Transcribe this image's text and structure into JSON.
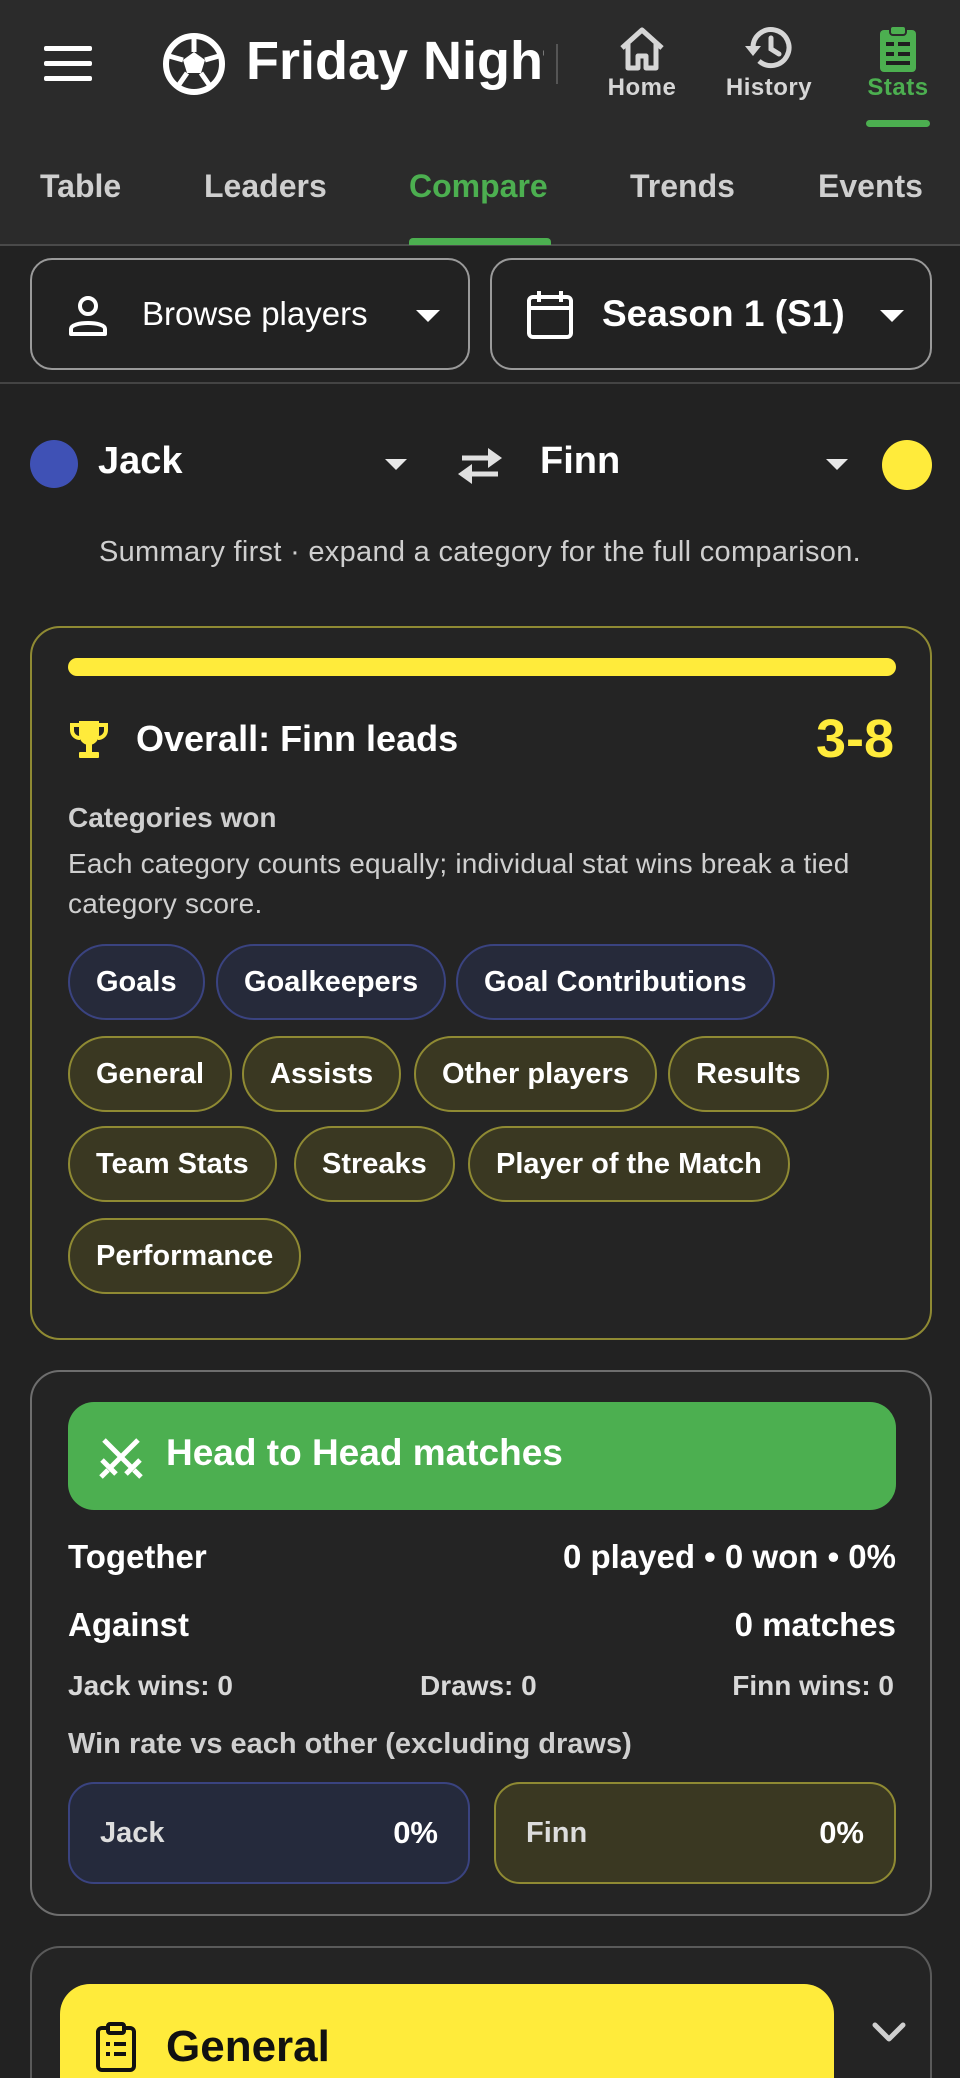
{
  "app": {
    "title": "Friday Night",
    "nav": [
      {
        "label": "Home",
        "icon": "home-icon"
      },
      {
        "label": "History",
        "icon": "history-icon"
      },
      {
        "label": "Stats",
        "icon": "stats-clipboard-icon",
        "active": true
      }
    ]
  },
  "tabs": [
    {
      "label": "Table"
    },
    {
      "label": "Leaders"
    },
    {
      "label": "Compare",
      "active": true
    },
    {
      "label": "Trends"
    },
    {
      "label": "Events"
    }
  ],
  "filters": {
    "browse_label": "Browse players",
    "season_label": "Season 1 (S1)"
  },
  "players": {
    "left": {
      "name": "Jack",
      "color": "#3f51b5"
    },
    "right": {
      "name": "Finn",
      "color": "#ffeb3b"
    }
  },
  "summary_note": "Summary first · expand a category for the full comparison.",
  "overall": {
    "title": "Overall: Finn leads",
    "score": "3-8",
    "categories_won_label": "Categories won",
    "description": "Each category counts equally; individual stat wins break a tied category score.",
    "chips": [
      {
        "label": "Goals",
        "winner": "Jack"
      },
      {
        "label": "Goalkeepers",
        "winner": "Jack"
      },
      {
        "label": "Goal Contributions",
        "winner": "Jack"
      },
      {
        "label": "General",
        "winner": "Finn"
      },
      {
        "label": "Assists",
        "winner": "Finn"
      },
      {
        "label": "Other players",
        "winner": "Finn"
      },
      {
        "label": "Results",
        "winner": "Finn"
      },
      {
        "label": "Team Stats",
        "winner": "Finn"
      },
      {
        "label": "Streaks",
        "winner": "Finn"
      },
      {
        "label": "Player of the Match",
        "winner": "Finn"
      },
      {
        "label": "Performance",
        "winner": "Finn"
      }
    ]
  },
  "h2h": {
    "title": "Head to Head matches",
    "together_label": "Together",
    "together_value": "0 played • 0 won • 0%",
    "against_label": "Against",
    "against_value": "0 matches",
    "left_wins": "Jack wins: 0",
    "draws": "Draws: 0",
    "right_wins": "Finn wins: 0",
    "winrate_note": "Win rate vs each other (excluding draws)",
    "left_rate_name": "Jack",
    "left_rate": "0%",
    "right_rate_name": "Finn",
    "right_rate": "0%"
  },
  "general": {
    "title": "General"
  }
}
